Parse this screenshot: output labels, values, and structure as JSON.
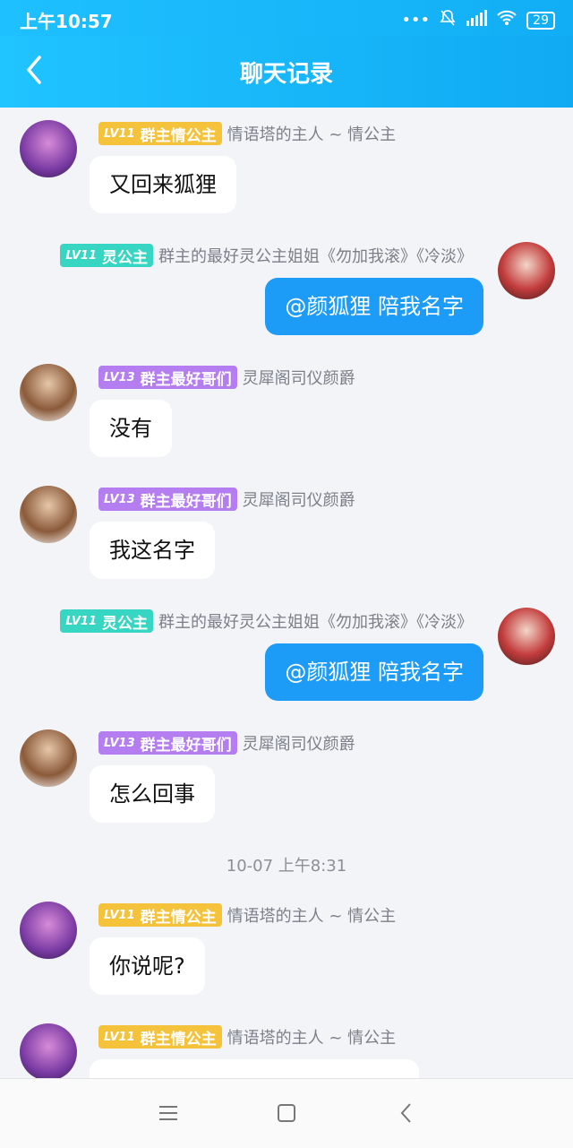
{
  "status": {
    "time": "上午10:57",
    "battery": "29"
  },
  "header": {
    "title": "聊天记录"
  },
  "messages": [
    {
      "badge_lv": "LV11",
      "badge_text": "群主情公主",
      "nick": "情语塔的主人 ~ 情公主",
      "text": "又回来狐狸"
    },
    {
      "badge_lv": "LV11",
      "badge_text": "灵公主",
      "nick": "群主的最好灵公主姐姐《勿加我滚》《冷淡》",
      "text": "@颜狐狸 陪我名字"
    },
    {
      "badge_lv": "LV13",
      "badge_text": "群主最好哥们",
      "nick": "灵犀阁司仪颜爵",
      "text": "没有"
    },
    {
      "badge_lv": "LV13",
      "badge_text": "群主最好哥们",
      "nick": "灵犀阁司仪颜爵",
      "text": "我这名字"
    },
    {
      "badge_lv": "LV11",
      "badge_text": "灵公主",
      "nick": "群主的最好灵公主姐姐《勿加我滚》《冷淡》",
      "text": "@颜狐狸 陪我名字"
    },
    {
      "badge_lv": "LV13",
      "badge_text": "群主最好哥们",
      "nick": "灵犀阁司仪颜爵",
      "text": "怎么回事"
    },
    {
      "badge_lv": "LV11",
      "badge_text": "群主情公主",
      "nick": "情语塔的主人 ~ 情公主",
      "text": "你说呢?"
    },
    {
      "badge_lv": "LV11",
      "badge_text": "群主情公主",
      "nick": "情语塔的主人 ~ 情公主",
      "text": ""
    }
  ],
  "time_divider": "10-07 上午8:31",
  "colors": {
    "accent": "#1ec0ff",
    "bubble_mine": "#1c9bf7"
  }
}
